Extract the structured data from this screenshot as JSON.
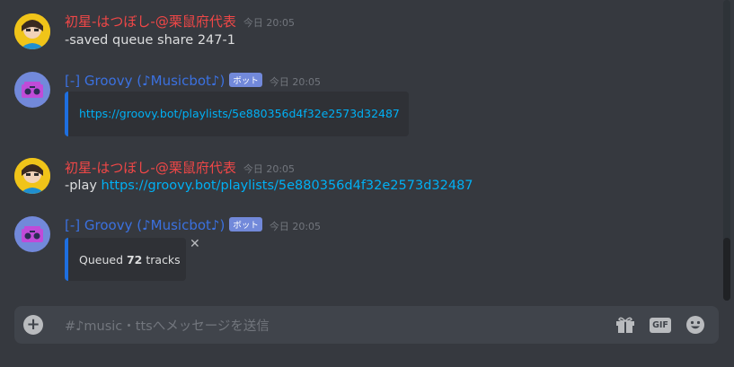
{
  "messages": [
    {
      "author": "初星-はつぼし-@栗鼠府代表",
      "timestamp": "今日 20:05",
      "content": "-saved queue share 247-1"
    },
    {
      "author": "[-] Groovy (♪Musicbot♪)",
      "badge": "ボット",
      "timestamp": "今日 20:05",
      "embed_link": "https://groovy.bot/playlists/5e880356d4f32e2573d32487"
    },
    {
      "author": "初星-はつぼし-@栗鼠府代表",
      "timestamp": "今日 20:05",
      "content_prefix": "-play ",
      "content_link": "https://groovy.bot/playlists/5e880356d4f32e2573d32487"
    },
    {
      "author": "[-] Groovy (♪Musicbot♪)",
      "badge": "ボット",
      "timestamp": "今日 20:05",
      "embed_prefix": "Queued ",
      "embed_count": "72",
      "embed_suffix": " tracks",
      "close_glyph": "✕"
    }
  ],
  "composer": {
    "placeholder": "#♪music・ttsへメッセージを送信",
    "gif_label": "GIF"
  },
  "icons": [
    "add-icon",
    "gift-icon",
    "gif-icon",
    "emoji-icon",
    "robot-avatar-icon"
  ],
  "colors": {
    "user_name": "#f04747",
    "bot_name": "#3b71e0",
    "link": "#00b0f4",
    "embed_border": "#1e6fe0",
    "bot_badge": "#7289da"
  }
}
